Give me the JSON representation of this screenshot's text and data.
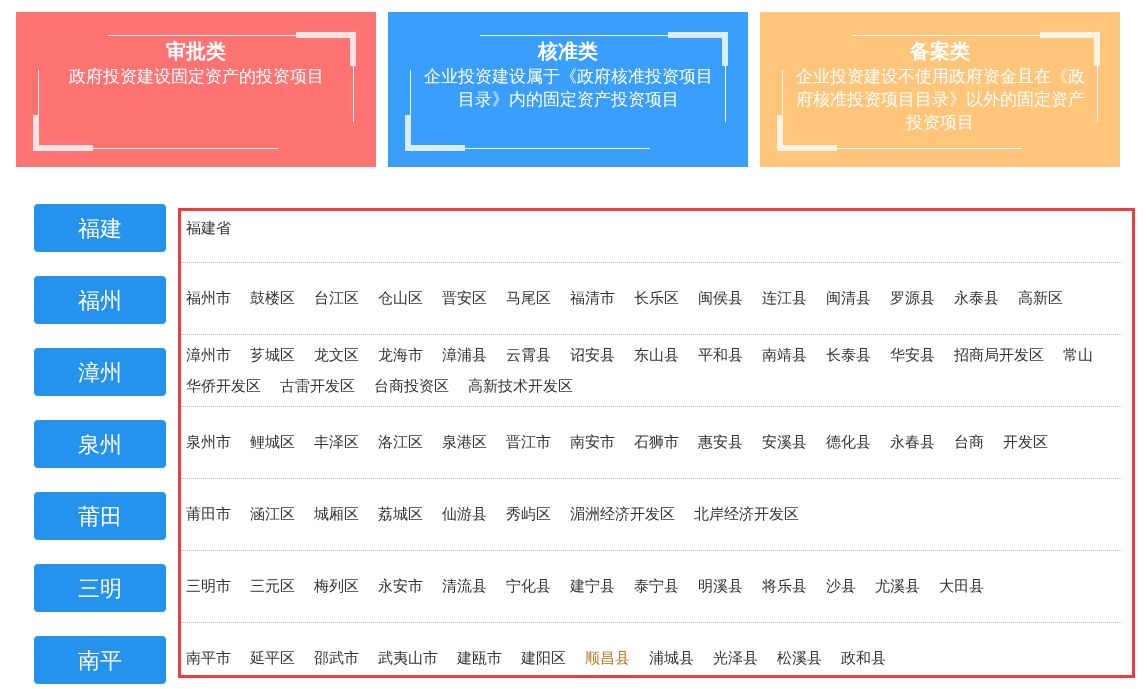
{
  "categories": [
    {
      "title": "审批类",
      "description": "政府投资建设固定资产的投资项目",
      "color": "#ff7373"
    },
    {
      "title": "核准类",
      "description": "企业投资建设属于《政府核准投资项目目录》内的固定资产投资项目",
      "color": "#3a9ffc"
    },
    {
      "title": "备案类",
      "description": "企业投资建设不使用政府资金且在《政府核准投资项目目录》以外的固定资产投资项目",
      "color": "#ffc57a"
    }
  ],
  "regions": [
    {
      "name": "福建",
      "items": [
        {
          "label": "福建省",
          "highlighted": false
        }
      ]
    },
    {
      "name": "福州",
      "items": [
        {
          "label": "福州市",
          "highlighted": false
        },
        {
          "label": "鼓楼区",
          "highlighted": false
        },
        {
          "label": "台江区",
          "highlighted": false
        },
        {
          "label": "仓山区",
          "highlighted": false
        },
        {
          "label": "晋安区",
          "highlighted": false
        },
        {
          "label": "马尾区",
          "highlighted": false
        },
        {
          "label": "福清市",
          "highlighted": false
        },
        {
          "label": "长乐区",
          "highlighted": false
        },
        {
          "label": "闽侯县",
          "highlighted": false
        },
        {
          "label": "连江县",
          "highlighted": false
        },
        {
          "label": "闽清县",
          "highlighted": false
        },
        {
          "label": "罗源县",
          "highlighted": false
        },
        {
          "label": "永泰县",
          "highlighted": false
        },
        {
          "label": "高新区",
          "highlighted": false
        }
      ]
    },
    {
      "name": "漳州",
      "items": [
        {
          "label": "漳州市",
          "highlighted": false
        },
        {
          "label": "芗城区",
          "highlighted": false
        },
        {
          "label": "龙文区",
          "highlighted": false
        },
        {
          "label": "龙海市",
          "highlighted": false
        },
        {
          "label": "漳浦县",
          "highlighted": false
        },
        {
          "label": "云霄县",
          "highlighted": false
        },
        {
          "label": "诏安县",
          "highlighted": false
        },
        {
          "label": "东山县",
          "highlighted": false
        },
        {
          "label": "平和县",
          "highlighted": false
        },
        {
          "label": "南靖县",
          "highlighted": false
        },
        {
          "label": "长泰县",
          "highlighted": false
        },
        {
          "label": "华安县",
          "highlighted": false
        },
        {
          "label": "招商局开发区",
          "highlighted": false
        },
        {
          "label": "常山",
          "highlighted": false
        },
        {
          "label": "华侨开发区",
          "highlighted": false
        },
        {
          "label": "古雷开发区",
          "highlighted": false
        },
        {
          "label": "台商投资区",
          "highlighted": false
        },
        {
          "label": "高新技术开发区",
          "highlighted": false
        }
      ]
    },
    {
      "name": "泉州",
      "items": [
        {
          "label": "泉州市",
          "highlighted": false
        },
        {
          "label": "鲤城区",
          "highlighted": false
        },
        {
          "label": "丰泽区",
          "highlighted": false
        },
        {
          "label": "洛江区",
          "highlighted": false
        },
        {
          "label": "泉港区",
          "highlighted": false
        },
        {
          "label": "晋江市",
          "highlighted": false
        },
        {
          "label": "南安市",
          "highlighted": false
        },
        {
          "label": "石狮市",
          "highlighted": false
        },
        {
          "label": "惠安县",
          "highlighted": false
        },
        {
          "label": "安溪县",
          "highlighted": false
        },
        {
          "label": "德化县",
          "highlighted": false
        },
        {
          "label": "永春县",
          "highlighted": false
        },
        {
          "label": "台商",
          "highlighted": false
        },
        {
          "label": "开发区",
          "highlighted": false
        }
      ]
    },
    {
      "name": "莆田",
      "items": [
        {
          "label": "莆田市",
          "highlighted": false
        },
        {
          "label": "涵江区",
          "highlighted": false
        },
        {
          "label": "城厢区",
          "highlighted": false
        },
        {
          "label": "荔城区",
          "highlighted": false
        },
        {
          "label": "仙游县",
          "highlighted": false
        },
        {
          "label": "秀屿区",
          "highlighted": false
        },
        {
          "label": "湄洲经济开发区",
          "highlighted": false
        },
        {
          "label": "北岸经济开发区",
          "highlighted": false
        }
      ]
    },
    {
      "name": "三明",
      "items": [
        {
          "label": "三明市",
          "highlighted": false
        },
        {
          "label": "三元区",
          "highlighted": false
        },
        {
          "label": "梅列区",
          "highlighted": false
        },
        {
          "label": "永安市",
          "highlighted": false
        },
        {
          "label": "清流县",
          "highlighted": false
        },
        {
          "label": "宁化县",
          "highlighted": false
        },
        {
          "label": "建宁县",
          "highlighted": false
        },
        {
          "label": "泰宁县",
          "highlighted": false
        },
        {
          "label": "明溪县",
          "highlighted": false
        },
        {
          "label": "将乐县",
          "highlighted": false
        },
        {
          "label": "沙县",
          "highlighted": false
        },
        {
          "label": "尤溪县",
          "highlighted": false
        },
        {
          "label": "大田县",
          "highlighted": false
        }
      ]
    },
    {
      "name": "南平",
      "items": [
        {
          "label": "南平市",
          "highlighted": false
        },
        {
          "label": "延平区",
          "highlighted": false
        },
        {
          "label": "邵武市",
          "highlighted": false
        },
        {
          "label": "武夷山市",
          "highlighted": false
        },
        {
          "label": "建瓯市",
          "highlighted": false
        },
        {
          "label": "建阳区",
          "highlighted": false
        },
        {
          "label": "顺昌县",
          "highlighted": true
        },
        {
          "label": "浦城县",
          "highlighted": false
        },
        {
          "label": "光泽县",
          "highlighted": false
        },
        {
          "label": "松溪县",
          "highlighted": false
        },
        {
          "label": "政和县",
          "highlighted": false
        }
      ]
    }
  ]
}
